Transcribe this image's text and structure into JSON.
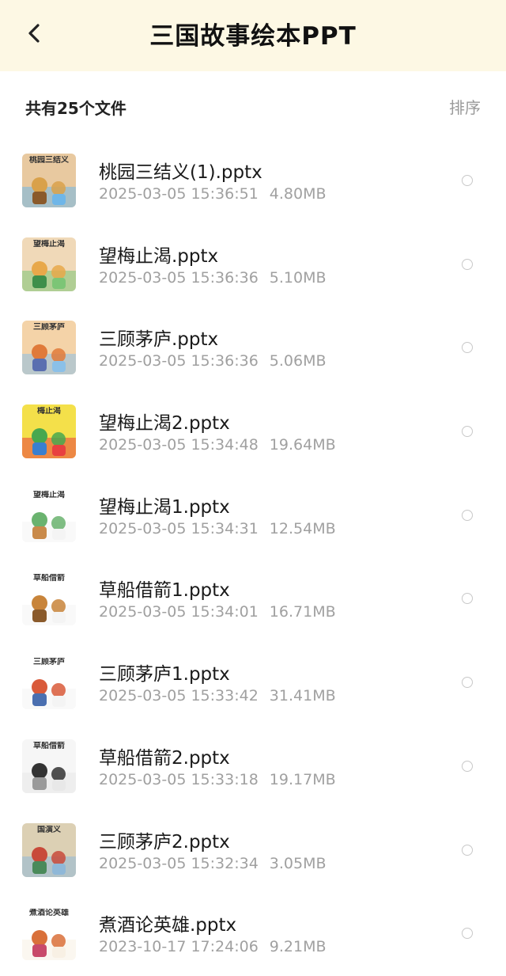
{
  "header": {
    "title": "三国故事绘本PPT",
    "back_icon": "chevron-left-icon"
  },
  "toolbar": {
    "file_count": "共有25个文件",
    "sort_label": "排序"
  },
  "files": [
    {
      "name": "桃园三结义(1).pptx",
      "date": "2025-03-05",
      "time": "15:36:51",
      "size": "4.80MB",
      "thumb_text": "桃园三结义"
    },
    {
      "name": "望梅止渴.pptx",
      "date": "2025-03-05",
      "time": "15:36:36",
      "size": "5.10MB",
      "thumb_text": "望梅止渴"
    },
    {
      "name": "三顾茅庐.pptx",
      "date": "2025-03-05",
      "time": "15:36:36",
      "size": "5.06MB",
      "thumb_text": "三顾茅庐"
    },
    {
      "name": "望梅止渴2.pptx",
      "date": "2025-03-05",
      "time": "15:34:48",
      "size": "19.64MB",
      "thumb_text": "梅止渴"
    },
    {
      "name": "望梅止渴1.pptx",
      "date": "2025-03-05",
      "time": "15:34:31",
      "size": "12.54MB",
      "thumb_text": "望梅止渴"
    },
    {
      "name": "草船借箭1.pptx",
      "date": "2025-03-05",
      "time": "15:34:01",
      "size": "16.71MB",
      "thumb_text": "草船借箭"
    },
    {
      "name": "三顾茅庐1.pptx",
      "date": "2025-03-05",
      "time": "15:33:42",
      "size": "31.41MB",
      "thumb_text": "三顾茅庐"
    },
    {
      "name": "草船借箭2.pptx",
      "date": "2025-03-05",
      "time": "15:33:18",
      "size": "19.17MB",
      "thumb_text": "草船借箭"
    },
    {
      "name": "三顾茅庐2.pptx",
      "date": "2025-03-05",
      "time": "15:32:34",
      "size": "3.05MB",
      "thumb_text": "国演义"
    },
    {
      "name": "煮酒论英雄.pptx",
      "date": "2023-10-17",
      "time": "17:24:06",
      "size": "9.21MB",
      "thumb_text": "煮酒论英雄"
    }
  ],
  "colors": {
    "header_bg": "#fdf8e4",
    "meta_text": "#a0a0a0",
    "radio_border": "#c8c8c8"
  }
}
